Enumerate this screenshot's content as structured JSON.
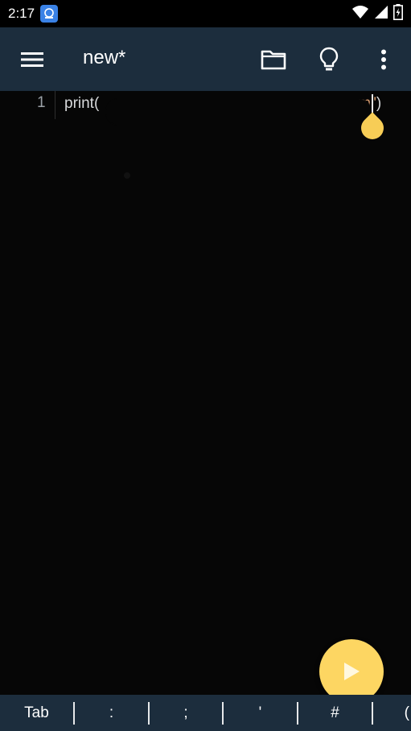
{
  "status_bar": {
    "time": "2:17",
    "icons": [
      "app-notification-icon",
      "wifi-icon",
      "signal-icon",
      "battery-charging-icon"
    ]
  },
  "app_bar": {
    "title": "new*",
    "actions": [
      "menu-icon",
      "folder-icon",
      "lightbulb-icon",
      "more-vert-icon"
    ]
  },
  "editor": {
    "line_number": "1",
    "code_prefix": "print(",
    "code_visible_string_end": "m\"",
    "code_suffix": ")"
  },
  "key_bar": {
    "keys": [
      "Tab",
      ":",
      ";",
      "'",
      "#",
      "("
    ]
  },
  "colors": {
    "app_bar": "#1c2d3d",
    "background": "#060606",
    "accent": "#fdd662",
    "string": "#d59a6e"
  }
}
